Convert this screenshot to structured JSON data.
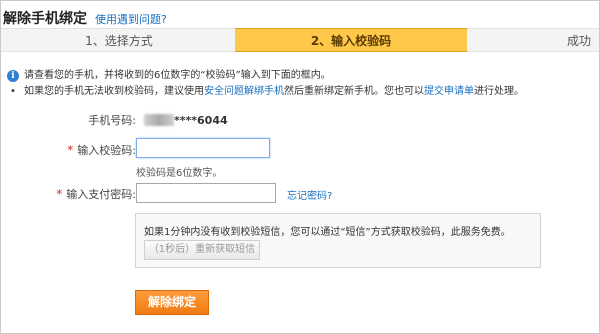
{
  "header": {
    "title": "解除手机绑定",
    "help_link": "使用遇到问题?"
  },
  "steps": [
    {
      "label": "1、选择方式"
    },
    {
      "label": "2、输入校验码"
    },
    {
      "label": "成功"
    }
  ],
  "notice": {
    "line1": "请查看您的手机，并将收到的6位数字的“校验码”输入到下面的框内。",
    "line2_pre": "如果您的手机无法收到校验码，建议使用",
    "line2_link1": "安全问题解绑手机",
    "line2_mid": "然后重新绑定新手机。您也可以",
    "line2_link2": "提交申请单",
    "line2_post": "进行处理。"
  },
  "form": {
    "phone_label": "手机号码:",
    "phone_suffix": "****6044",
    "code_label": "输入校验码:",
    "code_value": "",
    "code_hint": "校验码是6位数字。",
    "pay_label": "输入支付密码:",
    "pay_value": "",
    "forgot_link": "忘记密码?",
    "required_mark": "*"
  },
  "sms": {
    "text": "如果1分钟内没有收到校验短信，您可以通过“短信”方式获取校验码，此服务免费。",
    "resend_label": "（1秒后）重新获取短信"
  },
  "submit_label": "解除绑定",
  "colors": {
    "active_step": "#ffc84b",
    "link": "#1a6fc0",
    "primary": "#f07a10",
    "required": "#d9281e"
  }
}
